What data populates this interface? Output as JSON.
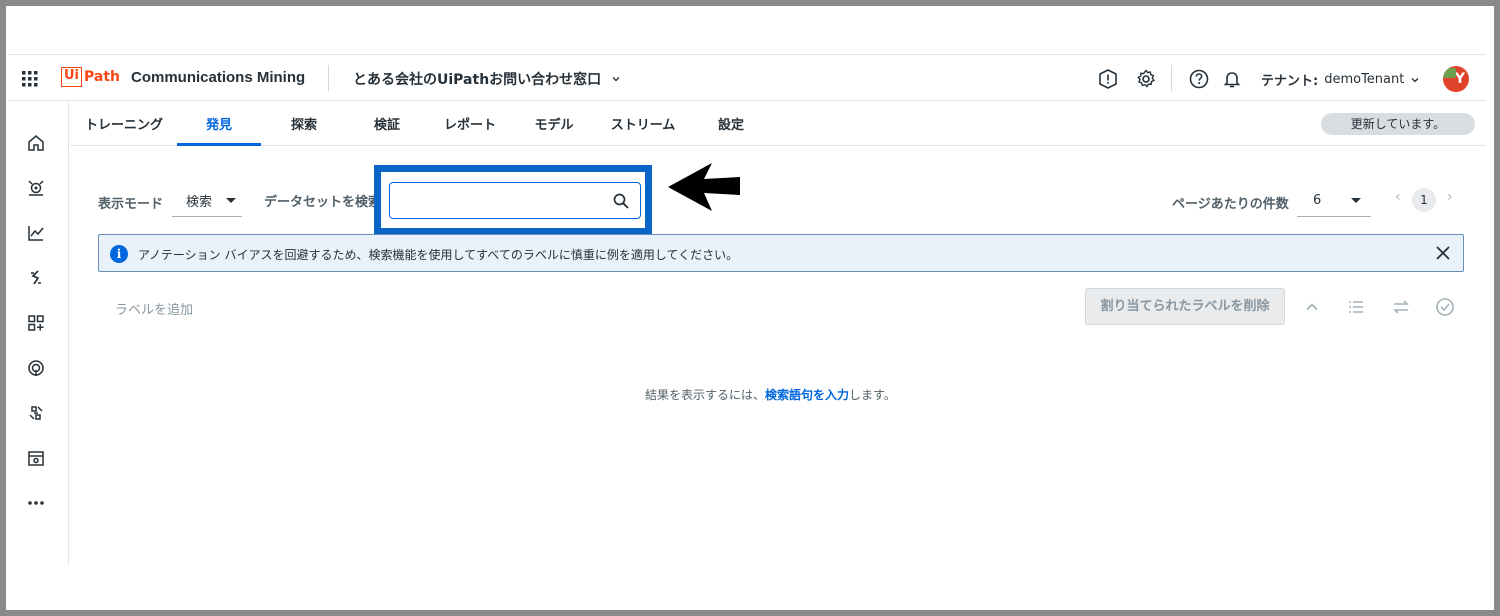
{
  "header": {
    "logo_box": "Ui",
    "logo_path": "Path",
    "product": "Communications Mining",
    "project": "とある会社のUiPathお問い合わせ窓口",
    "tenant_label": "テナント:",
    "tenant_value": "demoTenant",
    "avatar_initial": "Y"
  },
  "tabs": [
    {
      "label": "トレーニング"
    },
    {
      "label": "発見"
    },
    {
      "label": "探索"
    },
    {
      "label": "検証"
    },
    {
      "label": "レポート"
    },
    {
      "label": "モデル"
    },
    {
      "label": "ストリーム"
    },
    {
      "label": "設定"
    }
  ],
  "active_tab": "発見",
  "status": {
    "updating": "更新しています。"
  },
  "toolbar": {
    "mode_label": "表示モード",
    "mode_value": "検索",
    "search_label": "データセットを検索",
    "search_value": "",
    "per_page_label": "ページあたりの件数",
    "per_page_value": "6",
    "page_prev": "‹",
    "page_current": "1",
    "page_next": "›"
  },
  "banner": {
    "text": "アノテーション バイアスを回避するため、検索機能を使用してすべてのラベルに慎重に例を適用してください。"
  },
  "actions": {
    "add_label": "ラベルを追加",
    "remove_assigned": "割り当てられたラベルを削除"
  },
  "empty": {
    "prefix": "結果を表示するには、",
    "link": "検索語句を入力",
    "suffix": "します。"
  },
  "colors": {
    "accent": "#0067df",
    "brand": "#fa4616",
    "highlight_box": "#0866c6"
  }
}
